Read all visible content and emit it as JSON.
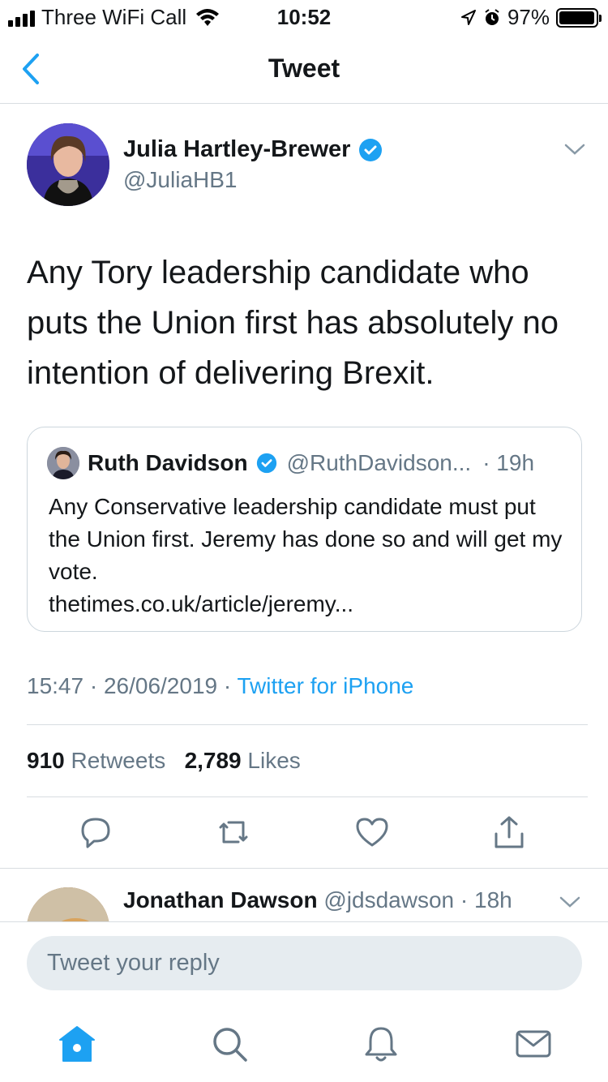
{
  "status_bar": {
    "carrier": "Three WiFi Call",
    "time": "10:52",
    "battery": "97%",
    "battery_level": 0.97
  },
  "nav": {
    "title": "Tweet"
  },
  "tweet": {
    "author_name": "Julia Hartley-Brewer",
    "author_handle": "@JuliaHB1",
    "text": "Any Tory leadership candidate who puts the Union first has absolutely no intention of delivering Brexit.",
    "quoted": {
      "name": "Ruth Davidson",
      "handle": "@RuthDavidson...",
      "time": "· 19h",
      "text": "Any Conservative leadership candidate must put the Union first. Jeremy has done so and will get my vote.",
      "link": "thetimes.co.uk/article/jeremy..."
    },
    "timestamp": "15:47 · 26/06/2019 ·",
    "source": "Twitter for iPhone",
    "retweets_count": "910",
    "retweets_label": "Retweets",
    "likes_count": "2,789",
    "likes_label": "Likes"
  },
  "reply_preview": {
    "name": "Jonathan Dawson",
    "handle": "@jdsdawson",
    "time": "· 18h"
  },
  "compose": {
    "placeholder": "Tweet your reply"
  },
  "colors": {
    "accent": "#1da1f2",
    "secondary_text": "#657786",
    "divider": "#d8dde1"
  }
}
